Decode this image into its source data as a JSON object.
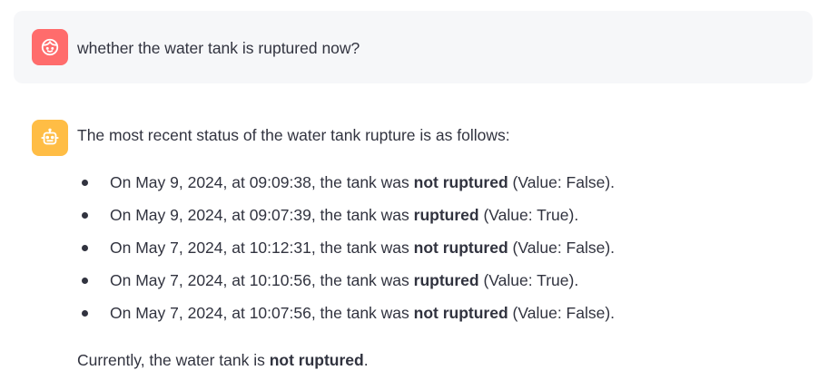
{
  "user_message": {
    "avatar_icon": "face-icon",
    "avatar_color": "#ff6c6c",
    "text": "whether the water tank is ruptured now?"
  },
  "assistant_message": {
    "avatar_icon": "robot-icon",
    "avatar_color": "#ffbd45",
    "intro": "The most recent status of the water tank rupture is as follows:",
    "items": [
      {
        "prefix": "On May 9, 2024, at 09:09:38, the tank was ",
        "status": "not ruptured",
        "suffix": " (Value: False)."
      },
      {
        "prefix": "On May 9, 2024, at 09:07:39, the tank was ",
        "status": "ruptured",
        "suffix": " (Value: True)."
      },
      {
        "prefix": "On May 7, 2024, at 10:12:31, the tank was ",
        "status": "not ruptured",
        "suffix": " (Value: False)."
      },
      {
        "prefix": "On May 7, 2024, at 10:10:56, the tank was ",
        "status": "ruptured",
        "suffix": " (Value: True)."
      },
      {
        "prefix": "On May 7, 2024, at 10:07:56, the tank was ",
        "status": "not ruptured",
        "suffix": " (Value: False)."
      }
    ],
    "summary_prefix": "Currently, the water tank is ",
    "summary_status": "not ruptured",
    "summary_suffix": "."
  }
}
